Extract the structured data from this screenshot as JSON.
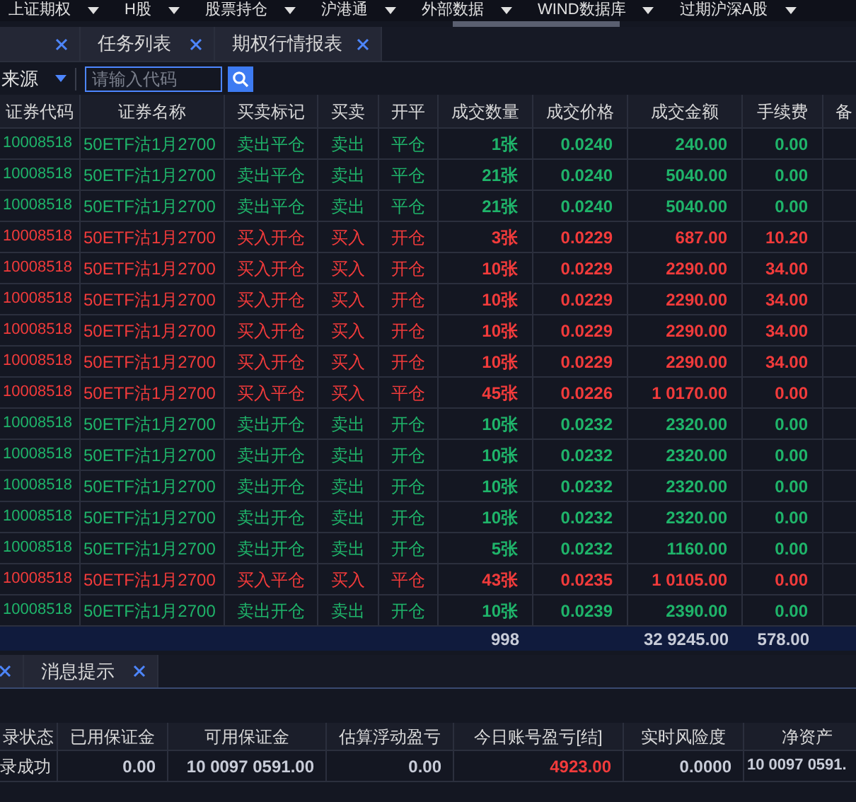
{
  "menu": [
    "上证期权",
    "H股",
    "股票持仓",
    "沪港通",
    "外部数据",
    "WIND数据库",
    "过期沪深A股"
  ],
  "tabs": [
    "任务列表",
    "期权行情报表"
  ],
  "filter": {
    "source_label": "来源",
    "placeholder": "请输入代码"
  },
  "table": {
    "columns": [
      "证券代码",
      "证券名称",
      "买卖标记",
      "买卖",
      "开平",
      "成交数量",
      "成交价格",
      "成交金额",
      "手续费",
      "备"
    ],
    "rows": [
      {
        "kind": "sell",
        "code": "10008518",
        "name": "50ETF沽1月2700",
        "mark": "卖出平仓",
        "side": "卖出",
        "open_close": "平仓",
        "qty": "1张",
        "price": "0.0240",
        "amount": "240.00",
        "fee": "0.00"
      },
      {
        "kind": "sell",
        "code": "10008518",
        "name": "50ETF沽1月2700",
        "mark": "卖出平仓",
        "side": "卖出",
        "open_close": "平仓",
        "qty": "21张",
        "price": "0.0240",
        "amount": "5040.00",
        "fee": "0.00"
      },
      {
        "kind": "sell",
        "code": "10008518",
        "name": "50ETF沽1月2700",
        "mark": "卖出平仓",
        "side": "卖出",
        "open_close": "平仓",
        "qty": "21张",
        "price": "0.0240",
        "amount": "5040.00",
        "fee": "0.00"
      },
      {
        "kind": "buy",
        "code": "10008518",
        "name": "50ETF沽1月2700",
        "mark": "买入开仓",
        "side": "买入",
        "open_close": "开仓",
        "qty": "3张",
        "price": "0.0229",
        "amount": "687.00",
        "fee": "10.20"
      },
      {
        "kind": "buy",
        "code": "10008518",
        "name": "50ETF沽1月2700",
        "mark": "买入开仓",
        "side": "买入",
        "open_close": "开仓",
        "qty": "10张",
        "price": "0.0229",
        "amount": "2290.00",
        "fee": "34.00"
      },
      {
        "kind": "buy",
        "code": "10008518",
        "name": "50ETF沽1月2700",
        "mark": "买入开仓",
        "side": "买入",
        "open_close": "开仓",
        "qty": "10张",
        "price": "0.0229",
        "amount": "2290.00",
        "fee": "34.00"
      },
      {
        "kind": "buy",
        "code": "10008518",
        "name": "50ETF沽1月2700",
        "mark": "买入开仓",
        "side": "买入",
        "open_close": "开仓",
        "qty": "10张",
        "price": "0.0229",
        "amount": "2290.00",
        "fee": "34.00"
      },
      {
        "kind": "buy",
        "code": "10008518",
        "name": "50ETF沽1月2700",
        "mark": "买入开仓",
        "side": "买入",
        "open_close": "开仓",
        "qty": "10张",
        "price": "0.0229",
        "amount": "2290.00",
        "fee": "34.00"
      },
      {
        "kind": "buy",
        "code": "10008518",
        "name": "50ETF沽1月2700",
        "mark": "买入平仓",
        "side": "买入",
        "open_close": "平仓",
        "qty": "45张",
        "price": "0.0226",
        "amount": "1 0170.00",
        "fee": "0.00"
      },
      {
        "kind": "sell",
        "code": "10008518",
        "name": "50ETF沽1月2700",
        "mark": "卖出开仓",
        "side": "卖出",
        "open_close": "开仓",
        "qty": "10张",
        "price": "0.0232",
        "amount": "2320.00",
        "fee": "0.00"
      },
      {
        "kind": "sell",
        "code": "10008518",
        "name": "50ETF沽1月2700",
        "mark": "卖出开仓",
        "side": "卖出",
        "open_close": "开仓",
        "qty": "10张",
        "price": "0.0232",
        "amount": "2320.00",
        "fee": "0.00"
      },
      {
        "kind": "sell",
        "code": "10008518",
        "name": "50ETF沽1月2700",
        "mark": "卖出开仓",
        "side": "卖出",
        "open_close": "开仓",
        "qty": "10张",
        "price": "0.0232",
        "amount": "2320.00",
        "fee": "0.00"
      },
      {
        "kind": "sell",
        "code": "10008518",
        "name": "50ETF沽1月2700",
        "mark": "卖出开仓",
        "side": "卖出",
        "open_close": "开仓",
        "qty": "10张",
        "price": "0.0232",
        "amount": "2320.00",
        "fee": "0.00"
      },
      {
        "kind": "sell",
        "code": "10008518",
        "name": "50ETF沽1月2700",
        "mark": "卖出开仓",
        "side": "卖出",
        "open_close": "开仓",
        "qty": "5张",
        "price": "0.0232",
        "amount": "1160.00",
        "fee": "0.00"
      },
      {
        "kind": "buy",
        "code": "10008518",
        "name": "50ETF沽1月2700",
        "mark": "买入平仓",
        "side": "买入",
        "open_close": "平仓",
        "qty": "43张",
        "price": "0.0235",
        "amount": "1 0105.00",
        "fee": "0.00"
      },
      {
        "kind": "sell",
        "code": "10008518",
        "name": "50ETF沽1月2700",
        "mark": "卖出开仓",
        "side": "卖出",
        "open_close": "开仓",
        "qty": "10张",
        "price": "0.0239",
        "amount": "2390.00",
        "fee": "0.00"
      }
    ],
    "totals": {
      "qty": "998",
      "amount": "32 9245.00",
      "fee": "578.00"
    }
  },
  "bottom_tabs": [
    "消息提示"
  ],
  "account": {
    "columns": [
      "录状态",
      "已用保证金",
      "可用保证金",
      "估算浮动盈亏",
      "今日账号盈亏[结]",
      "实时风险度",
      "净资产"
    ],
    "row": [
      {
        "value": "录成功",
        "kind": "plain"
      },
      {
        "value": "0.00",
        "kind": "number"
      },
      {
        "value": "10 0097 0591.00",
        "kind": "number"
      },
      {
        "value": "0.00",
        "kind": "number"
      },
      {
        "value": "4923.00",
        "kind": "gain"
      },
      {
        "value": "0.0000",
        "kind": "number"
      },
      {
        "value": "10 0097 0591.",
        "kind": "number"
      }
    ]
  }
}
